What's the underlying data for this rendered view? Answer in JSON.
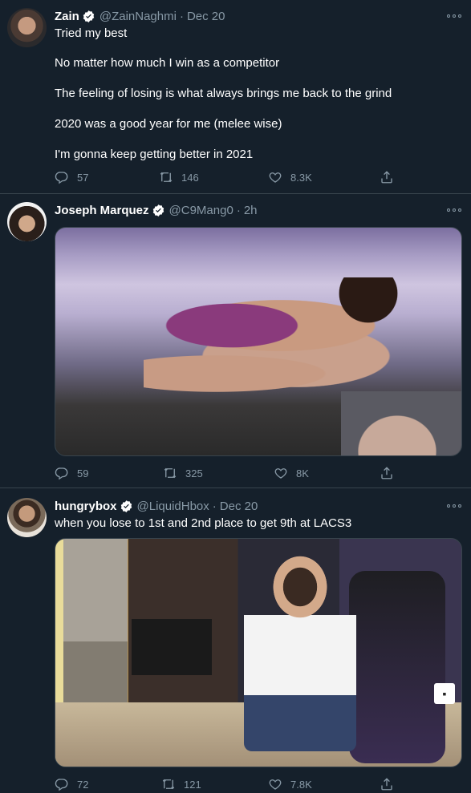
{
  "tweets": [
    {
      "name": "Zain",
      "handle": "@ZainNaghmi",
      "time": "Dec 20",
      "lines": [
        "Tried my best",
        "No matter how much I win as a competitor",
        "The feeling of losing is what always brings me back to the grind",
        "2020 was a good year for me (melee wise)",
        "I'm gonna keep getting better in 2021"
      ],
      "replies": "57",
      "retweets": "146",
      "likes": "8.3K"
    },
    {
      "name": "Joseph Marquez",
      "handle": "@C9Mang0",
      "time": "2h",
      "replies": "59",
      "retweets": "325",
      "likes": "8K"
    },
    {
      "name": "hungrybox",
      "handle": "@LiquidHbox",
      "time": "Dec 20",
      "text": "when you lose to 1st and 2nd place to get 9th at LACS3",
      "replies": "72",
      "retweets": "121",
      "likes": "7.8K"
    }
  ],
  "colors": {
    "background": "#15202b",
    "divider": "#38444d",
    "muted": "#8899a6",
    "verified": "#ffffff"
  },
  "icons": [
    "verified-badge-icon",
    "reply-icon",
    "retweet-icon",
    "like-icon",
    "share-icon",
    "more-icon"
  ]
}
